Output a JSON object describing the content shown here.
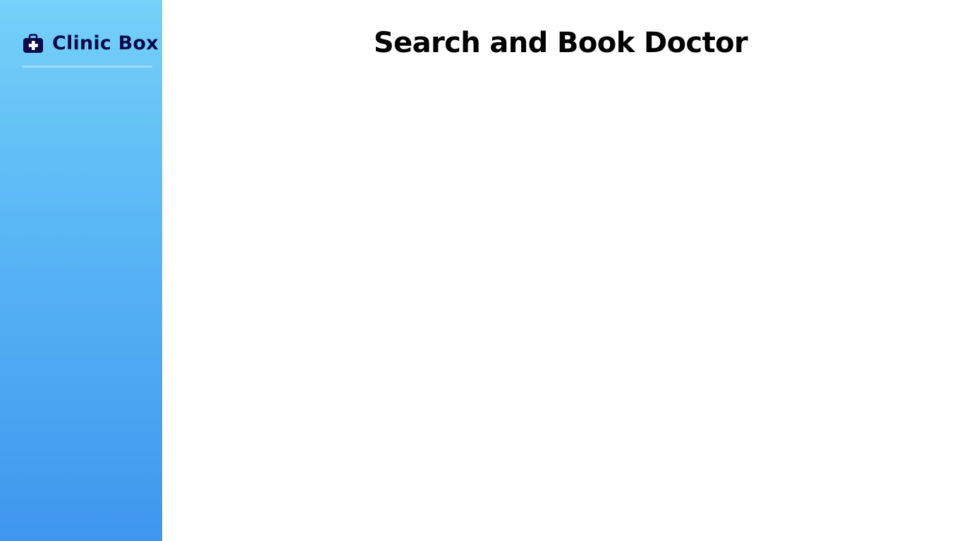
{
  "app": {
    "brand_name": "Clinic Box",
    "brand_icon": "medical-kit-icon"
  },
  "main": {
    "title": "Search and Book Doctor"
  },
  "colors": {
    "sidebar_gradient_top": "#75d1f8",
    "sidebar_gradient_bottom": "#3f96ee",
    "brand_text": "#0c0a4a",
    "title_text": "#000000",
    "background": "#ffffff"
  }
}
